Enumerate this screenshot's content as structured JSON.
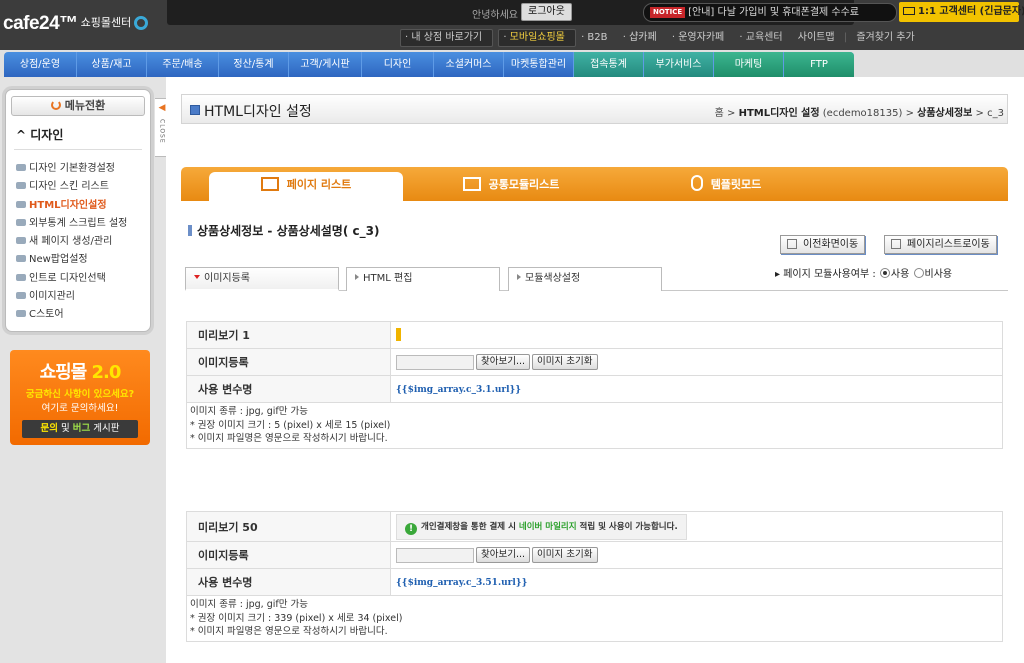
{
  "header": {
    "logo": "cafe24™",
    "logo_sub": "쇼핑몰센터",
    "greeting": "안녕하세요",
    "logout": "로그아웃",
    "notice_badge": "NOTICE",
    "notice_text": "[안내] 다날 가입비 및 휴대폰결제 수수료",
    "callcenter": "1:1 고객센터 (긴급문자)",
    "sublinks": [
      "내 상점 바로가기",
      "모바일쇼핑몰",
      "B2B",
      "샵카페",
      "운영자카페",
      "교육센터"
    ],
    "util_links": [
      "사이트맵",
      "즐겨찾기 추가"
    ]
  },
  "gnb": [
    "상점/운영",
    "상품/재고",
    "주문/배송",
    "정산/통계",
    "고객/게시판",
    "디자인",
    "소셜커머스",
    "마켓통합관리",
    "접속통계",
    "부가서비스",
    "마케팅",
    "FTP"
  ],
  "sidebar": {
    "menu_toggle": "메뉴전환",
    "section": "디자인",
    "close": "CLOSE",
    "items": [
      "디자인 기본환경설정",
      "디자인 스킨 리스트",
      "HTML디자인설정",
      "외부통계 스크립트 설정",
      "새 페이지 생성/관리",
      "New팝업설정",
      "인트로 디자인선택",
      "이미지관리",
      "C스토어"
    ],
    "banner": {
      "title": "쇼핑몰",
      "version": "2.0",
      "line1": "궁금하신 사항이 있으세요?",
      "line2": "여기로 문의하세요!",
      "btn_a": "문의",
      "btn_and": "및",
      "btn_b": "버그",
      "btn_c": "게시판"
    }
  },
  "main": {
    "title": "HTML디자인 설정",
    "breadcrumb": {
      "home": "홈",
      "sep": ">",
      "c1": "HTML디자인 설정",
      "c1_note": "(ecdemo18135)",
      "c2": "상품상세정보",
      "c3": "c_3"
    },
    "tabs": [
      "페이지 리스트",
      "공통모듈리스트",
      "템플릿모드"
    ],
    "section_title": "상품상세정보 - 상품상세설명( c_3)",
    "btn_prev": "이전화면이동",
    "btn_list": "페이지리스트로이동",
    "subtabs": [
      "이미지등록",
      "HTML 편집",
      "모듈색상설정"
    ],
    "usage_label": "페이지 모듈사용여부 :",
    "usage_on": "사용",
    "usage_off": "비사용",
    "blocks": [
      {
        "preview_label": "미리보기 1",
        "upload_label": "이미지등록",
        "browse": "찾아보기...",
        "reset": "이미지 초기화",
        "var_label": "사용 변수명",
        "var_value": "{{$img_array.c_3.1.url}}",
        "notes": [
          "이미지 종류 : jpg, gif만 가능",
          "* 권장 이미지 크기 : 5 (pixel) x 세로 15 (pixel)",
          "* 이미지 파일명은 영문으로 작성하시기 바랍니다."
        ]
      },
      {
        "preview_label": "미리보기 50",
        "preview_text_a": "개인결제창을 통한 결제 시",
        "preview_text_b": "네이버 마일리지",
        "preview_text_c": "적립 및 사용이 가능합니다.",
        "upload_label": "이미지등록",
        "browse": "찾아보기...",
        "reset": "이미지 초기화",
        "var_label": "사용 변수명",
        "var_value": "{{$img_array.c_3.51.url}}",
        "notes": [
          "이미지 종류 : jpg, gif만 가능",
          "* 권장 이미지 크기 : 339 (pixel) x 세로 34 (pixel)",
          "* 이미지 파일명은 영문으로 작성하시기 바랍니다."
        ]
      }
    ]
  },
  "colors": {
    "gnb_blue": "#2e66c0",
    "gnb_teal": "#248a7e",
    "tab_orange": "#e88a12",
    "active_menu": "#e05a1b",
    "var_blue": "#1f5fb0"
  }
}
